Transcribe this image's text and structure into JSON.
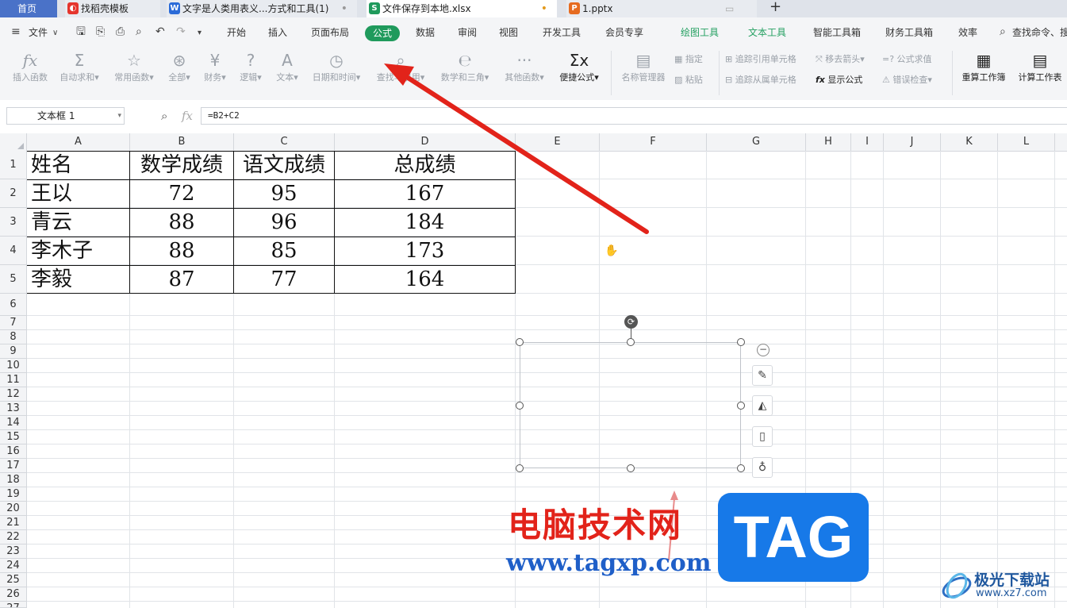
{
  "tabs": [
    {
      "label": "首页",
      "icon": "home",
      "active": false
    },
    {
      "label": "找稻壳模板",
      "icon": "docer-logo-icon"
    },
    {
      "label": "文字是人类用表义...方式和工具(1)",
      "icon": "word-doc-icon",
      "status": "•"
    },
    {
      "label": "文件保存到本地.xlsx",
      "icon": "spreadsheet-icon",
      "status": "•"
    },
    {
      "label": "1.pptx",
      "icon": "presentation-icon"
    }
  ],
  "new_tab": "+",
  "menu": {
    "file": "文件",
    "items": [
      "开始",
      "插入",
      "页面布局",
      "公式",
      "数据",
      "审阅",
      "视图",
      "开发工具",
      "会员专享",
      "绘图工具",
      "文本工具",
      "智能工具箱",
      "财务工具箱",
      "效率"
    ],
    "active": "公式",
    "search": "查找命令、搜"
  },
  "ribbon": {
    "buttons": [
      {
        "label": "插入函数",
        "icon": "fx-icon"
      },
      {
        "label": "自动求和▾",
        "icon": "sigma-icon"
      },
      {
        "label": "常用函数▾",
        "icon": "star-icon"
      },
      {
        "label": "全部▾",
        "icon": "asterisk-icon"
      },
      {
        "label": "财务▾",
        "icon": "yen-icon"
      },
      {
        "label": "逻辑▾",
        "icon": "question-icon"
      },
      {
        "label": "文本▾",
        "icon": "text-a-icon"
      },
      {
        "label": "日期和时间▾",
        "icon": "clock-icon"
      },
      {
        "label": "查找与引用▾",
        "icon": "lookup-icon"
      },
      {
        "label": "数学和三角▾",
        "icon": "math-icon"
      },
      {
        "label": "其他函数▾",
        "icon": "more-icon"
      },
      {
        "label": "便捷公式▾",
        "icon": "sigma-x-icon"
      },
      {
        "label": "名称管理器",
        "icon": "name-manager-icon"
      }
    ],
    "small": {
      "specify": "指定",
      "paste": "粘贴",
      "trace_precedents": "追踪引用单元格",
      "trace_dependents": "追踪从属单元格",
      "remove_arrows": "移去箭头▾",
      "show_formulas": "显示公式",
      "evaluate": "=? 公式求值",
      "error_check": "错误检查▾"
    },
    "recalc_workbook": "重算工作簿",
    "calc_sheet": "计算工作表"
  },
  "formula_bar": {
    "name_box": "文本框 1",
    "formula": "=B2+C2"
  },
  "columns": [
    "A",
    "B",
    "C",
    "D",
    "E",
    "F",
    "G",
    "H",
    "I",
    "J",
    "K",
    "L"
  ],
  "rows": [
    "1",
    "2",
    "3",
    "4",
    "5",
    "6",
    "7",
    "8",
    "9",
    "10",
    "11",
    "12",
    "13",
    "14",
    "15",
    "16",
    "17",
    "18",
    "19",
    "20",
    "21",
    "22",
    "23",
    "24",
    "25",
    "26",
    "27"
  ],
  "table": {
    "header": [
      "姓名",
      "数学成绩",
      "语文成绩",
      "总成绩"
    ],
    "rows": [
      [
        "王以",
        "72",
        "95",
        "167"
      ],
      [
        "青云",
        "88",
        "96",
        "184"
      ],
      [
        "李木子",
        "88",
        "85",
        "173"
      ],
      [
        "李毅",
        "87",
        "77",
        "164"
      ]
    ]
  },
  "watermark": {
    "site_cn": "电脑技术网",
    "site_url": "www.tagxp.com",
    "tag": "TAG",
    "brand": "极光下载站",
    "brand_url": "www.xz7.com"
  },
  "colors": {
    "accent": "#1f9a5c",
    "arrow": "#e2231a",
    "tag_bg": "#1779e8"
  }
}
